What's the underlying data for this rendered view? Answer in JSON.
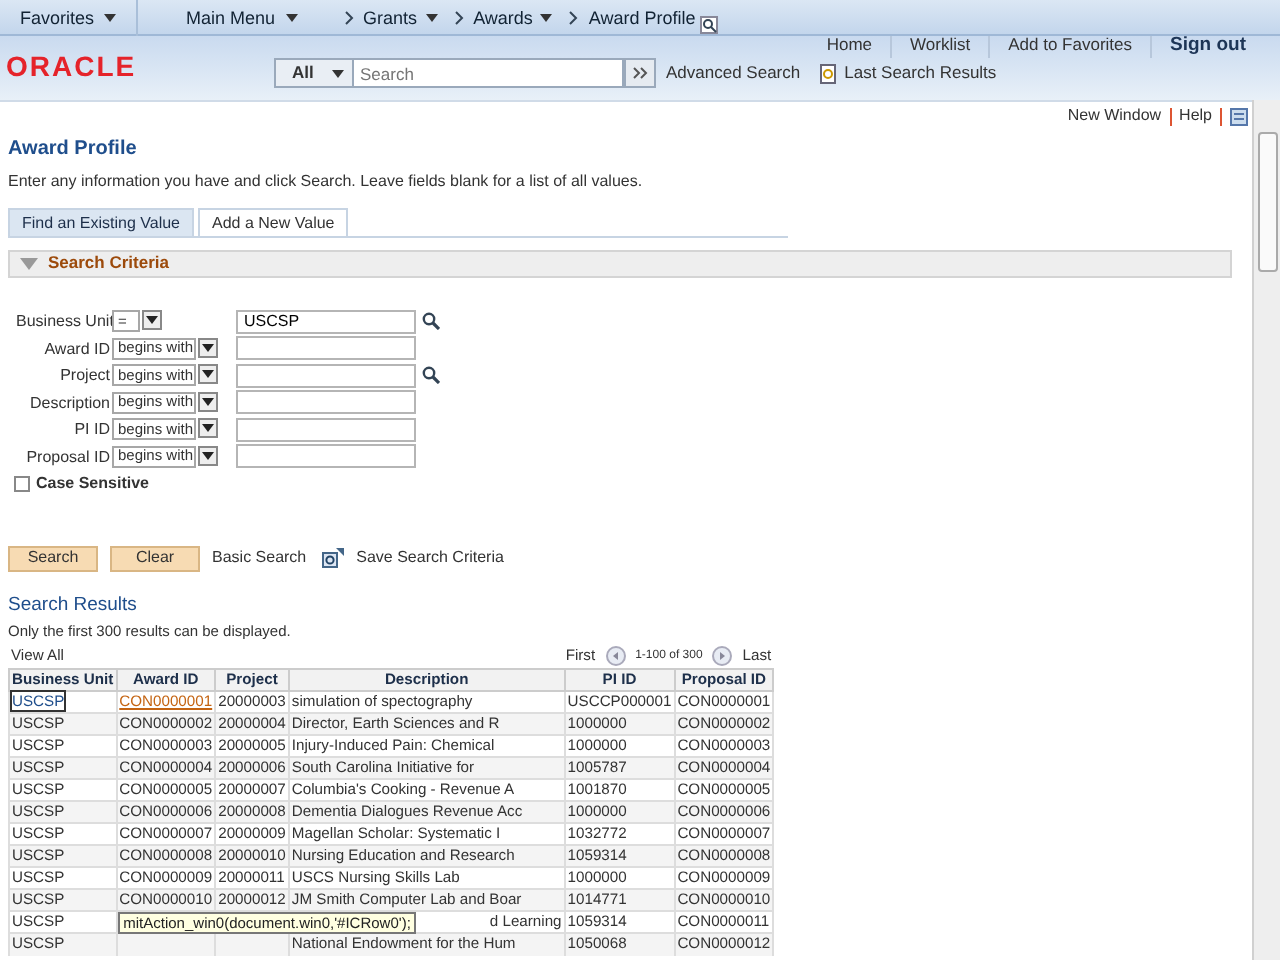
{
  "nav_bar": {
    "favorites": "Favorites",
    "main_menu": "Main Menu",
    "breadcrumbs": [
      "Grants",
      "Awards",
      "Award Profile"
    ]
  },
  "header": {
    "logo": "ORACLE",
    "links": [
      "Home",
      "Worklist",
      "Add to Favorites",
      "Sign out"
    ],
    "search_scope": "All",
    "search_placeholder": "Search",
    "advanced_search": "Advanced Search",
    "last_results": "Last Search Results"
  },
  "page_links": [
    "New Window",
    "Help"
  ],
  "title": "Award Profile",
  "instructions": "Enter any information you have and click Search. Leave fields blank for a list of all values.",
  "tabs": [
    {
      "label": "Find an Existing Value",
      "selected": true
    },
    {
      "label": "Add a New Value",
      "selected": false
    }
  ],
  "section": {
    "title": "Search Criteria",
    "expanded": true
  },
  "criteria": [
    {
      "label": "Business Unit",
      "operator": "=",
      "value": "USCSP",
      "lookup": true
    },
    {
      "label": "Award ID",
      "operator": "begins with",
      "lookup": false
    },
    {
      "label": "Project",
      "operator": "begins with",
      "lookup": true
    },
    {
      "label": "Description",
      "operator": "begins with",
      "lookup": false
    },
    {
      "label": "PI ID",
      "operator": "begins with",
      "lookup": false
    },
    {
      "label": "Proposal ID",
      "operator": "begins with",
      "lookup": false
    }
  ],
  "case_sensitive": {
    "label": "Case Sensitive",
    "checked": false
  },
  "buttons": [
    "Search",
    "Clear"
  ],
  "links": [
    "Basic Search",
    "Save Search Criteria"
  ],
  "results": {
    "title": "Search Results",
    "note": "Only the first 300 results can be displayed.",
    "view_all": "View All",
    "first": "First",
    "range": "1-100 of 300",
    "last": "Last",
    "columns": [
      "Business Unit",
      "Award ID",
      "Project",
      "Description",
      "PI ID",
      "Proposal ID"
    ],
    "rows": [
      {
        "cells": [
          "USCSP",
          "CON0000001",
          "20000003",
          "simulation of spectography",
          "USCCP000001",
          "CON0000001"
        ],
        "hovered": true
      },
      {
        "cells": [
          "USCSP",
          "CON0000002",
          "20000004",
          "Director, Earth Sciences and R",
          "1000000",
          "CON0000002"
        ],
        "hovered": false
      },
      {
        "cells": [
          "USCSP",
          "CON0000003",
          "20000005",
          "Injury-Induced Pain: Chemical",
          "1000000",
          "CON0000003"
        ],
        "hovered": false
      },
      {
        "cells": [
          "USCSP",
          "CON0000004",
          "20000006",
          "South Carolina Initiative for",
          "1005787",
          "CON0000004"
        ],
        "hovered": false
      },
      {
        "cells": [
          "USCSP",
          "CON0000005",
          "20000007",
          "Columbia's Cooking - Revenue A",
          "1001870",
          "CON0000005"
        ],
        "hovered": false
      },
      {
        "cells": [
          "USCSP",
          "CON0000006",
          "20000008",
          "Dementia Dialogues Revenue Acc",
          "1000000",
          "CON0000006"
        ],
        "hovered": false
      },
      {
        "cells": [
          "USCSP",
          "CON0000007",
          "20000009",
          "Magellan Scholar: Systematic I",
          "1032772",
          "CON0000007"
        ],
        "hovered": false
      },
      {
        "cells": [
          "USCSP",
          "CON0000008",
          "20000010",
          "Nursing Education and Research",
          "1059314",
          "CON0000008"
        ],
        "hovered": false
      },
      {
        "cells": [
          "USCSP",
          "CON0000009",
          "20000011",
          "USCS Nursing Skills Lab",
          "1000000",
          "CON0000009"
        ],
        "hovered": false
      },
      {
        "cells": [
          "USCSP",
          "CON0000010",
          "20000012",
          "JM Smith Computer Lab and Boar",
          "1014771",
          "CON0000010"
        ],
        "hovered": false
      },
      {
        "cells": [
          "USCSP",
          null,
          null,
          "d Learning",
          "1059314",
          "CON0000011"
        ],
        "hovered": false
      },
      {
        "cells": [
          "USCSP",
          null,
          null,
          "National Endowment for the Hum",
          "1050068",
          "CON0000012"
        ],
        "hovered": false
      }
    ]
  },
  "tooltip": "mitAction_win0(document.win0,'#ICRow0');"
}
